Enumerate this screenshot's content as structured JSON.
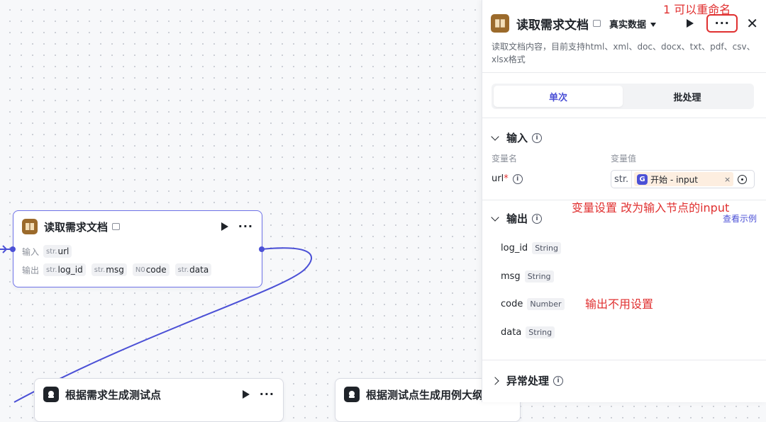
{
  "canvas": {
    "main_node": {
      "title": "读取需求文档",
      "input_label": "输入",
      "output_label": "输出",
      "inputs": [
        {
          "type": "str.",
          "name": "url"
        }
      ],
      "outputs": [
        {
          "type": "str.",
          "name": "log_id"
        },
        {
          "type": "str.",
          "name": "msg"
        },
        {
          "type": "N0",
          "name": "code"
        },
        {
          "type": "str.",
          "name": "data"
        }
      ]
    },
    "node2": {
      "title": "根据需求生成测试点"
    },
    "node3": {
      "title": "根据测试点生成用例大纲"
    }
  },
  "panel": {
    "title": "读取需求文档",
    "mode": "真实数据",
    "description": "读取文档内容，目前支持html、xml、doc、docx、txt、pdf、csv、xlsx格式",
    "tabs": [
      {
        "label": "单次",
        "active": true
      },
      {
        "label": "批处理",
        "active": false
      }
    ],
    "input_section": {
      "title": "输入",
      "col_name": "变量名",
      "col_value": "变量值",
      "var_name": "url",
      "required_mark": "*",
      "value_type": "str.",
      "value_ref": "开始 - input",
      "value_ref_icon": "G"
    },
    "output_section": {
      "title": "输出",
      "link": "查看示例",
      "items": [
        {
          "name": "log_id",
          "type": "String"
        },
        {
          "name": "msg",
          "type": "String"
        },
        {
          "name": "code",
          "type": "Number"
        },
        {
          "name": "data",
          "type": "String"
        }
      ]
    },
    "error_section": {
      "title": "异常处理"
    }
  },
  "annotations": {
    "rename": "1 可以重命名",
    "input_tip": "变量设置 改为输入节点的input",
    "output_tip": "输出不用设置"
  },
  "colors": {
    "accent": "#4b50d6",
    "annotation": "#e03030",
    "ref_bg": "#fdeee0"
  }
}
